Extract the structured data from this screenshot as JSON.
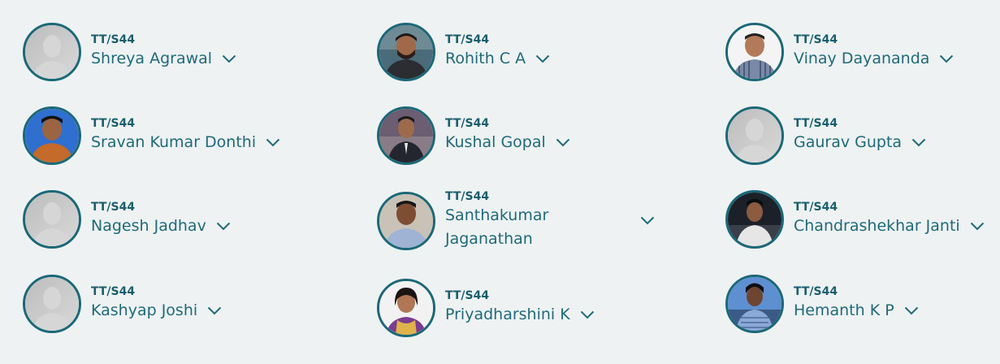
{
  "people": [
    {
      "code": "TT/S44",
      "name": "Shreya Agrawal",
      "photo": "placeholder-avatar"
    },
    {
      "code": "TT/S44",
      "name": "Rohith C A",
      "photo": "photo"
    },
    {
      "code": "TT/S44",
      "name": "Vinay Dayananda",
      "photo": "photo"
    },
    {
      "code": "TT/S44",
      "name": "Sravan Kumar Donthi",
      "photo": "photo"
    },
    {
      "code": "TT/S44",
      "name": "Kushal Gopal",
      "photo": "photo"
    },
    {
      "code": "TT/S44",
      "name": "Gaurav Gupta",
      "photo": "placeholder-avatar"
    },
    {
      "code": "TT/S44",
      "name": "Nagesh Jadhav",
      "photo": "placeholder-avatar"
    },
    {
      "code": "TT/S44",
      "name": "Santhakumar Jaganathan",
      "photo": "photo"
    },
    {
      "code": "TT/S44",
      "name": "Chandrashekhar Janti",
      "photo": "photo"
    },
    {
      "code": "TT/S44",
      "name": "Kashyap Joshi",
      "photo": "placeholder-avatar"
    },
    {
      "code": "TT/S44",
      "name": "Priyadharshini K",
      "photo": "photo"
    },
    {
      "code": "TT/S44",
      "name": "Hemanth K P",
      "photo": "photo"
    }
  ],
  "colors": {
    "background": "#eef2f3",
    "accent": "#1b6877",
    "text": "#1f6a79"
  },
  "icons": {
    "expand": "chevron-down-icon",
    "avatar": "person-silhouette-icon"
  }
}
